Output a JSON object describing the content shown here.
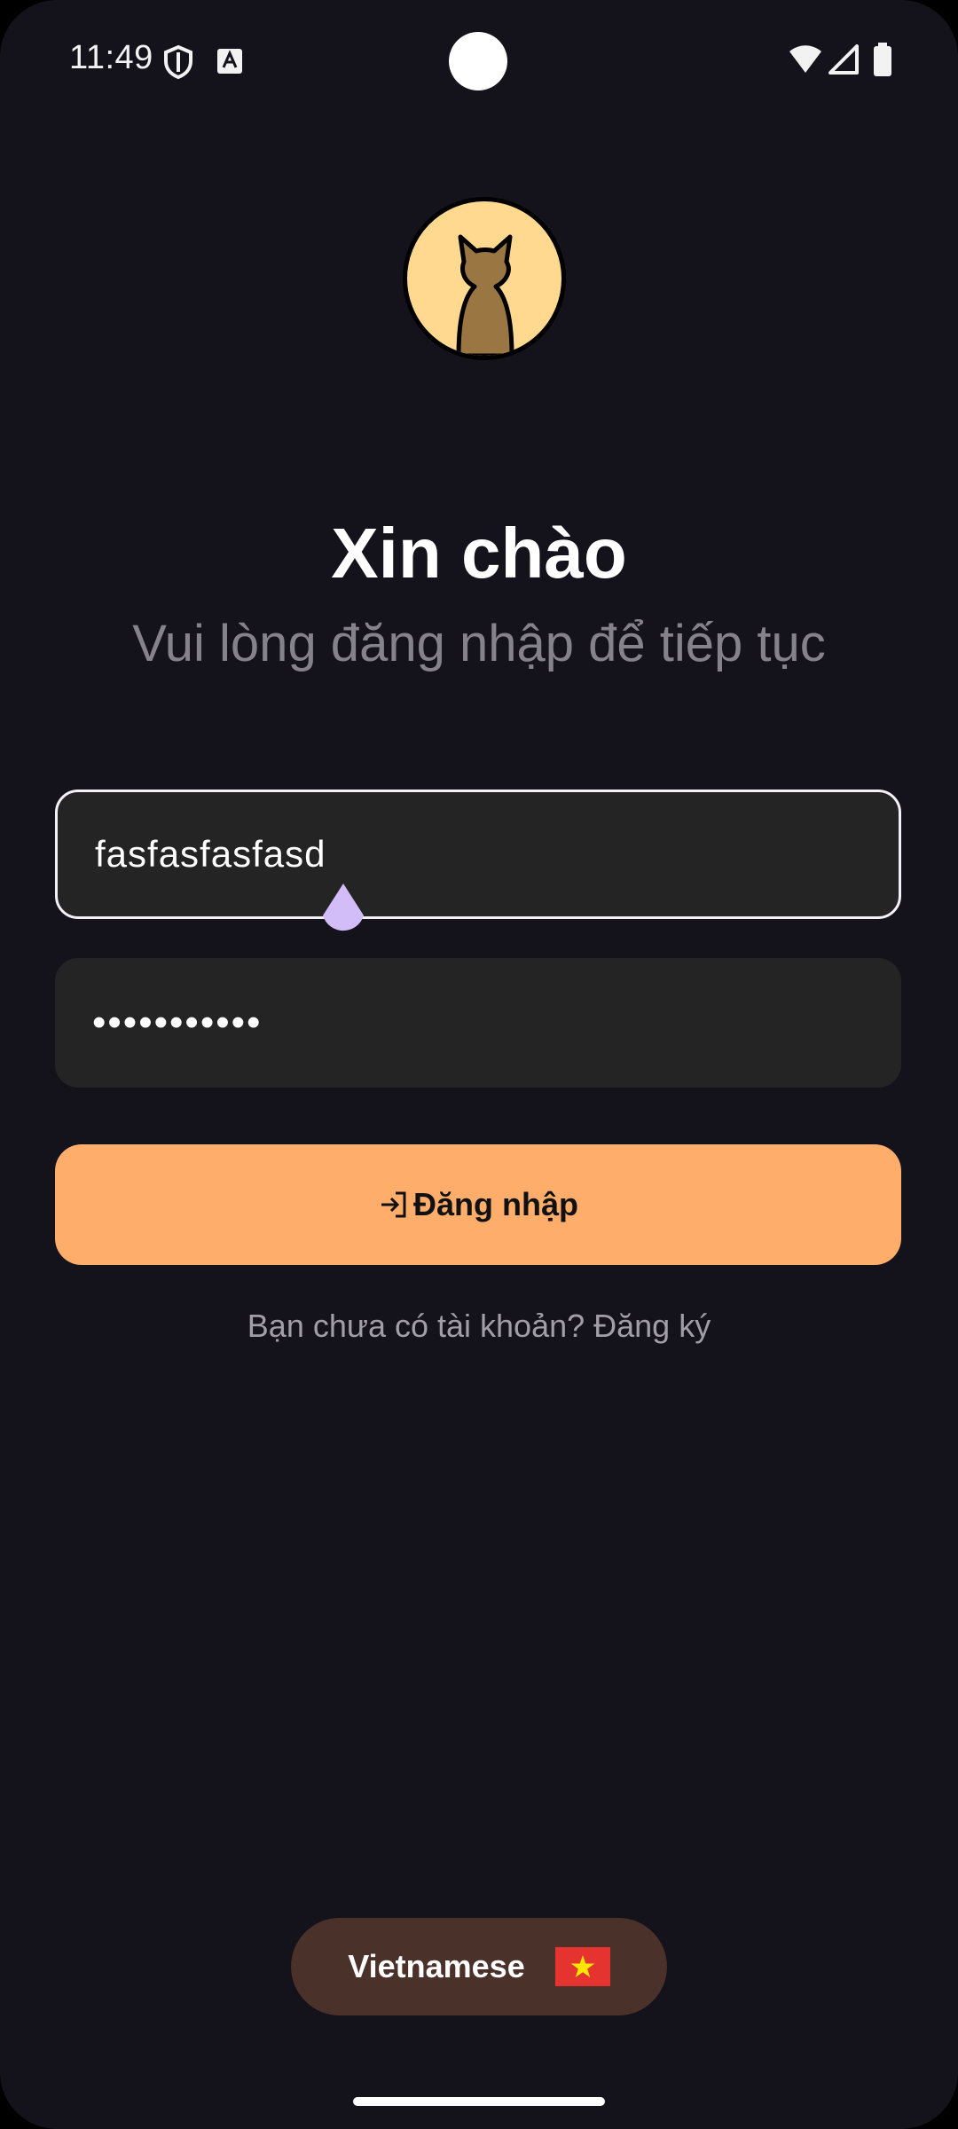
{
  "status_bar": {
    "time": "11:49",
    "icons": [
      "shield-icon",
      "a-badge-icon",
      "wifi-icon",
      "signal-icon",
      "battery-icon"
    ]
  },
  "login": {
    "greeting": "Xin chào",
    "subtitle": "Vui lòng đăng nhập để tiếp tục",
    "username_value": "fasfasfasfasd",
    "password_value": "•••••••••••",
    "login_button_label": "Đăng nhập",
    "signup_prompt": "Bạn chưa có tài khoản? Đăng ký"
  },
  "language": {
    "label": "Vietnamese",
    "flag": "vietnam-flag-icon"
  },
  "colors": {
    "background": "#14121a",
    "accent": "#ffad6b",
    "input_background": "#242424",
    "language_pill": "#4a3129",
    "cursor_handle": "#d2bdf9"
  }
}
